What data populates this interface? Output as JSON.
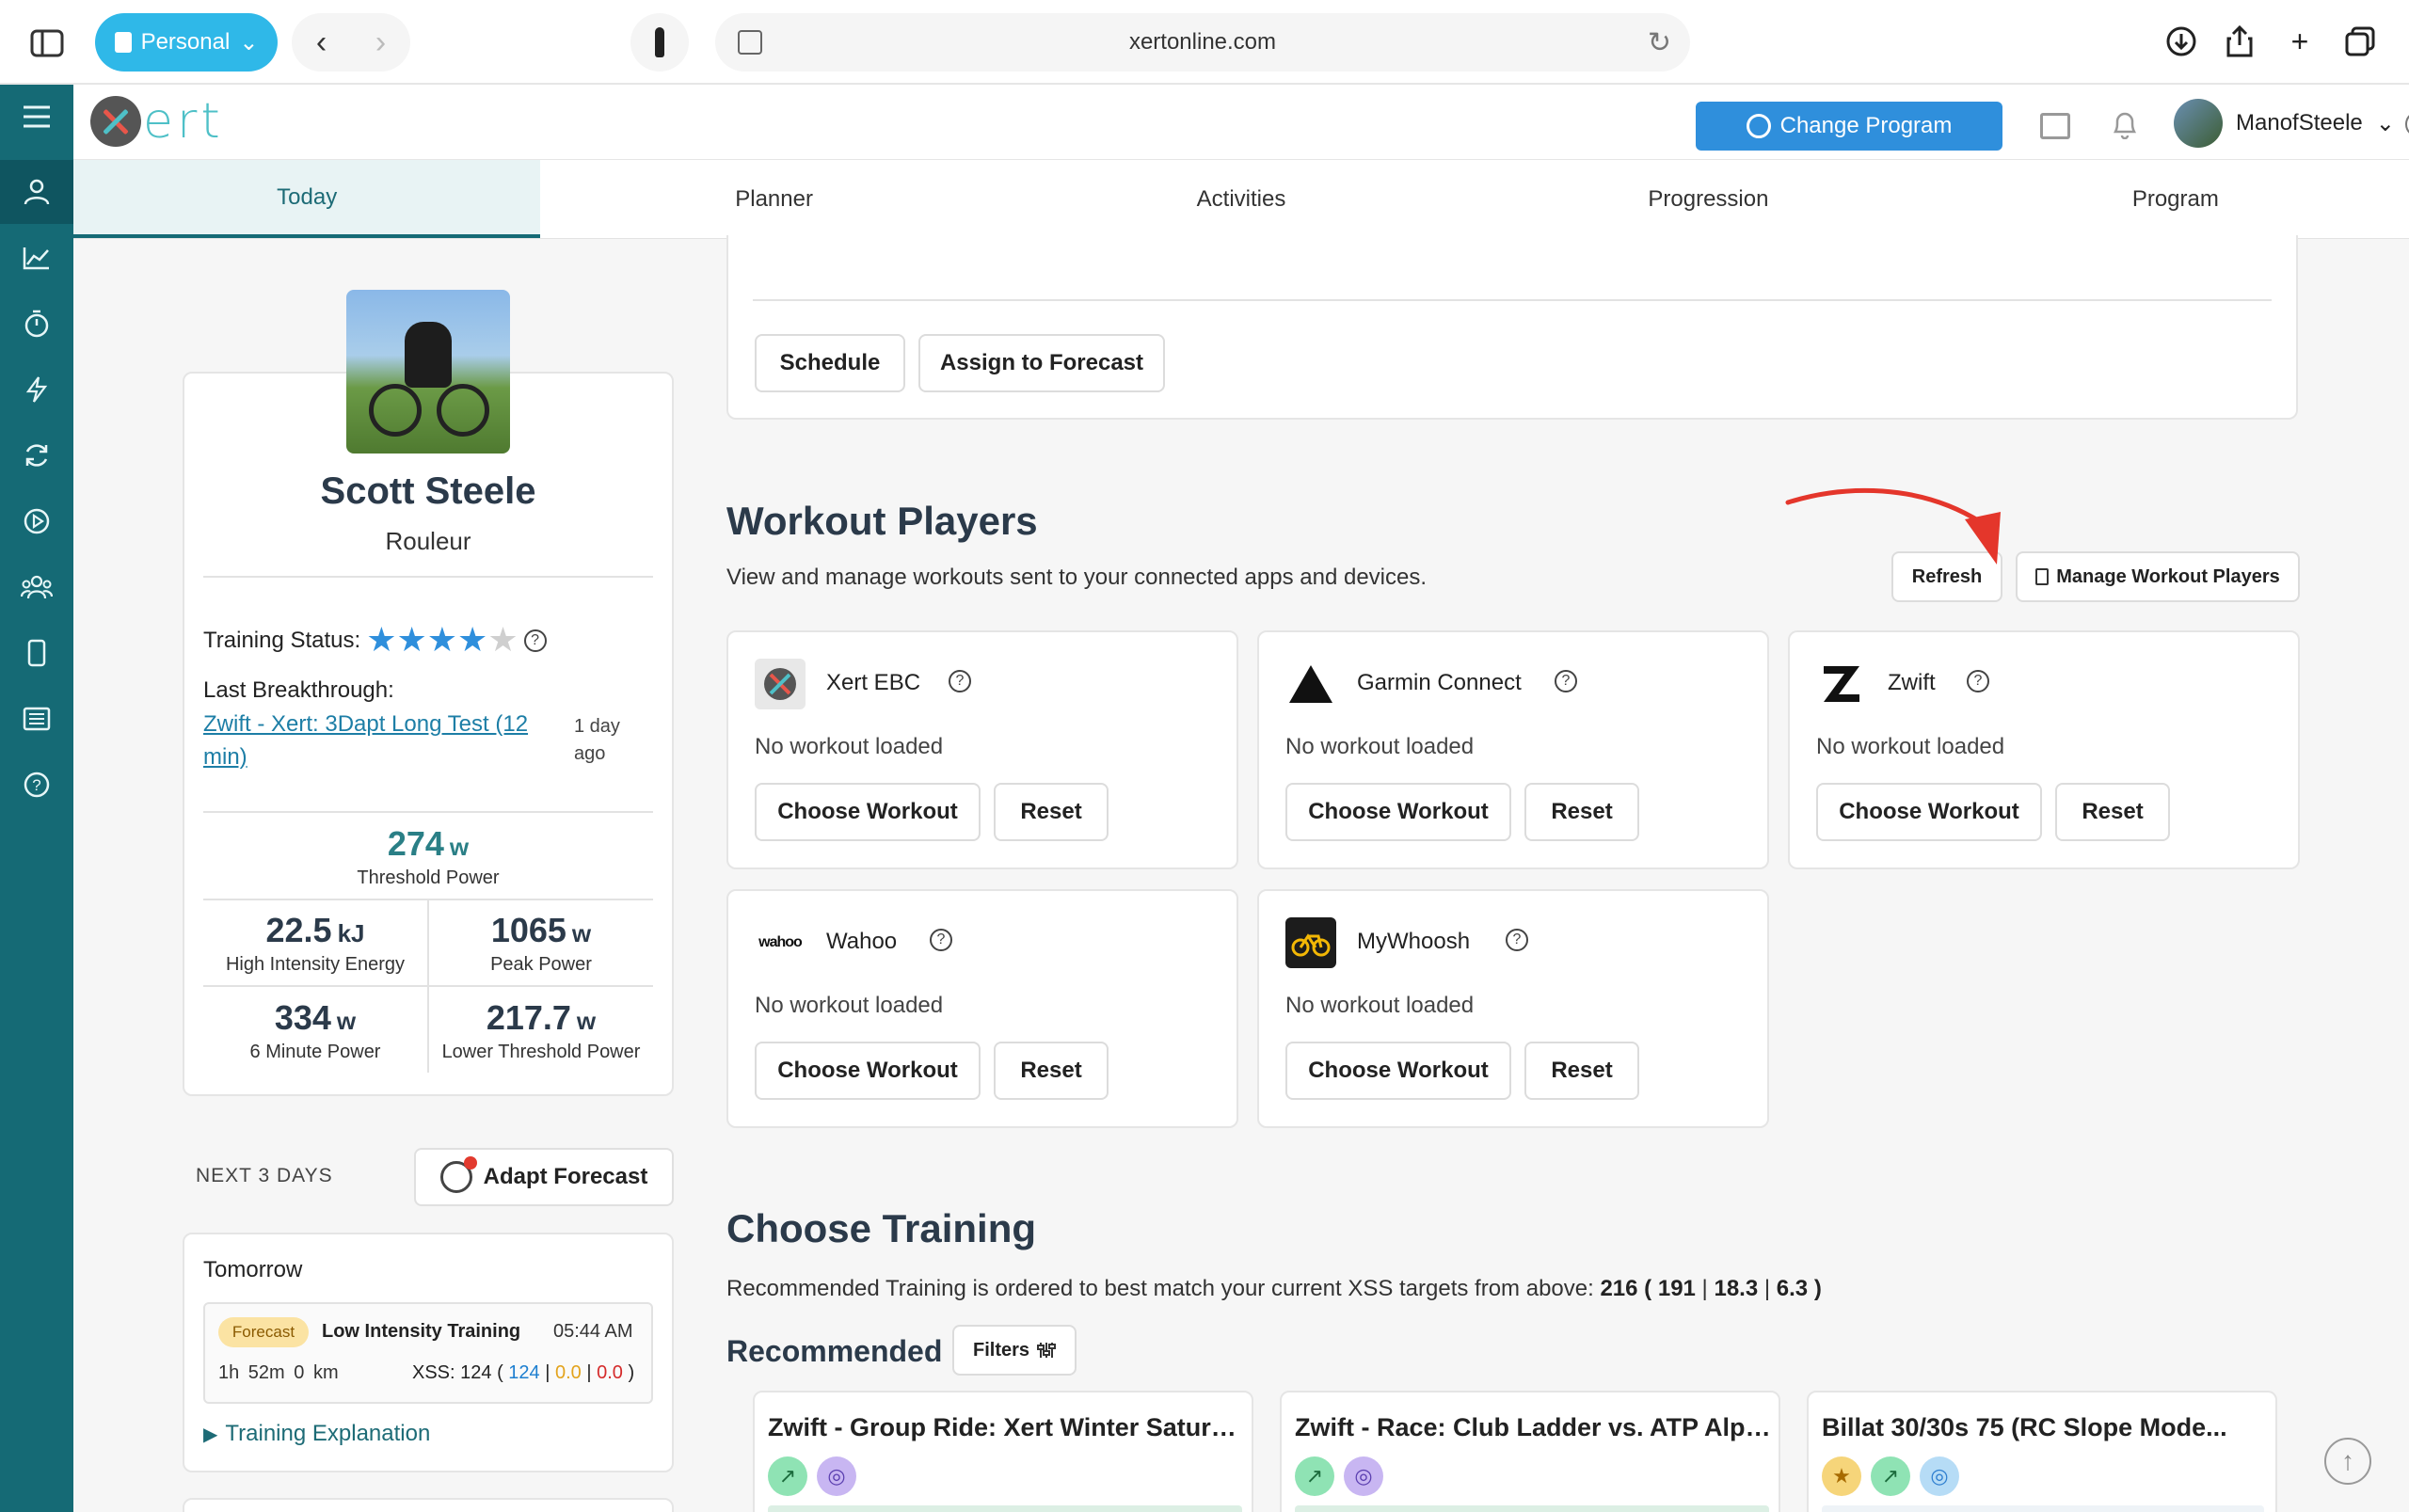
{
  "browser": {
    "profile_label": "Personal",
    "url": "xertonline.com"
  },
  "header": {
    "logo_text": "ert",
    "change_program_label": "Change Program",
    "username": "ManofSteele"
  },
  "tabs": [
    "Today",
    "Planner",
    "Activities",
    "Progression",
    "Program"
  ],
  "sidebar": {
    "items": [
      "menu-icon",
      "person-icon",
      "chart-icon",
      "stopwatch-icon",
      "bolt-icon",
      "sync-icon",
      "play-icon",
      "group-icon",
      "phone-icon",
      "news-icon",
      "help-icon"
    ]
  },
  "profile": {
    "name": "Scott Steele",
    "role": "Rouleur",
    "training_status_label": "Training Status:",
    "training_status_stars": 4,
    "training_status_max": 5,
    "last_breakthrough_label": "Last Breakthrough:",
    "last_breakthrough_link": "Zwift - Xert: 3Dapt Long Test (12 min)",
    "last_breakthrough_ago": "1 day ago",
    "stats": {
      "threshold": {
        "value": "274",
        "unit": "w",
        "label": "Threshold Power"
      },
      "hie": {
        "value": "22.5",
        "unit": "kJ",
        "label": "High Intensity Energy"
      },
      "peak": {
        "value": "1065",
        "unit": "w",
        "label": "Peak Power"
      },
      "six_min": {
        "value": "334",
        "unit": "w",
        "label": "6 Minute Power"
      },
      "ltp": {
        "value": "217.7",
        "unit": "w",
        "label": "Lower Threshold Power"
      }
    }
  },
  "next_days": {
    "label": "NEXT 3 DAYS",
    "adapt_label": "Adapt Forecast",
    "tomorrow": {
      "title": "Tomorrow",
      "badge": "Forecast",
      "workout": "Low Intensity Training",
      "time": "05:44 AM",
      "duration": "1h 52m",
      "distance": "0 km",
      "xss_label": "XSS:",
      "xss_total": "124",
      "xss_low": "124",
      "xss_high": "0.0",
      "xss_peak": "0.0"
    },
    "explanation_label": "Training Explanation"
  },
  "top_card": {
    "schedule_label": "Schedule",
    "assign_label": "Assign to Forecast"
  },
  "workout_players": {
    "title": "Workout Players",
    "subtitle": "View and manage workouts sent to your connected apps and devices.",
    "refresh_label": "Refresh",
    "manage_label": "Manage Workout Players",
    "choose_label": "Choose Workout",
    "reset_label": "Reset",
    "status": "No workout loaded",
    "players": [
      {
        "name": "Xert EBC",
        "logo": "xert-logo"
      },
      {
        "name": "Garmin Connect",
        "logo": "garmin-logo"
      },
      {
        "name": "Zwift",
        "logo": "zwift-logo"
      },
      {
        "name": "Wahoo",
        "logo": "wahoo-logo",
        "logo_text": "wahoo"
      },
      {
        "name": "MyWhoosh",
        "logo": "mywhoosh-logo"
      }
    ]
  },
  "choose_training": {
    "title": "Choose Training",
    "subtitle_prefix": "Recommended Training is ordered to best match your current XSS targets from above:",
    "xss_total": "216",
    "xss_low": "191",
    "xss_high": "18.3",
    "xss_peak": "6.3",
    "recommended_label": "Recommended",
    "filters_label": "Filters",
    "cards": [
      {
        "title": "Zwift - Group Ride: Xert Winter Saturd...",
        "chips": [
          "green",
          "purple"
        ]
      },
      {
        "title": "Zwift - Race: Club Ladder vs. ATP Alph...",
        "chips": [
          "green",
          "purple"
        ]
      },
      {
        "title": "Billat 30/30s 75 (RC Slope Mode...",
        "chips": [
          "gold",
          "green",
          "blue"
        ]
      }
    ]
  },
  "colors": {
    "sidebar": "#156a75",
    "accent_blue": "#2f8fdc",
    "xss_low": "#1d7fd0",
    "xss_high": "#e3a31c",
    "xss_peak": "#d42a2a",
    "annotation_arrow": "#e4362b"
  }
}
